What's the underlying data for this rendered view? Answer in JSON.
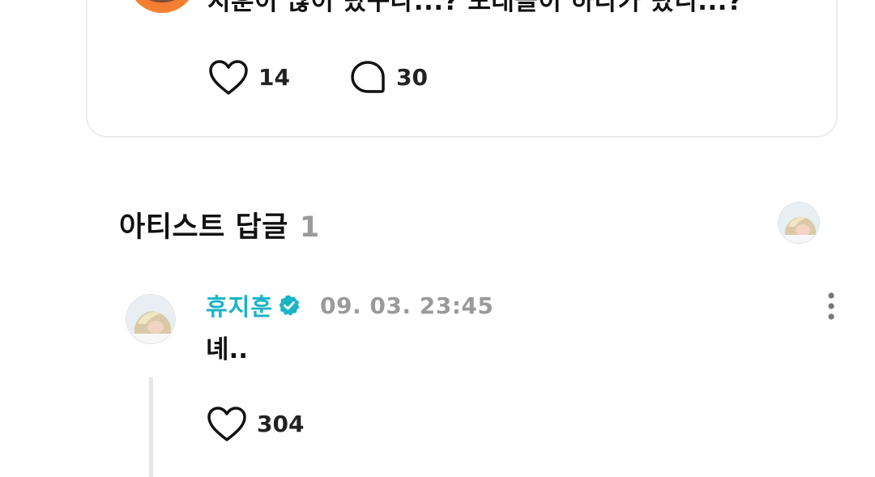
{
  "post": {
    "text": "지훈이 많이 탔구나...?  모래놀이 하다가 탔니...?",
    "like_count": "14",
    "comment_count": "30"
  },
  "artist_reply_section": {
    "title": "아티스트 답글",
    "count": "1"
  },
  "reply": {
    "author": "휴지훈",
    "timestamp": "09. 03. 23:45",
    "text": "녜..",
    "like_count": "304"
  },
  "colors": {
    "accent": "#1bb4c7",
    "muted": "#9a9a9a",
    "text": "#111111",
    "card_border": "#ececec",
    "thread_line": "#e6e6e6"
  },
  "icons": {
    "like": "heart-outline-icon",
    "comment": "speech-bubble-outline-icon",
    "verified": "verified-check-badge-icon",
    "more": "vertical-ellipsis-icon"
  }
}
